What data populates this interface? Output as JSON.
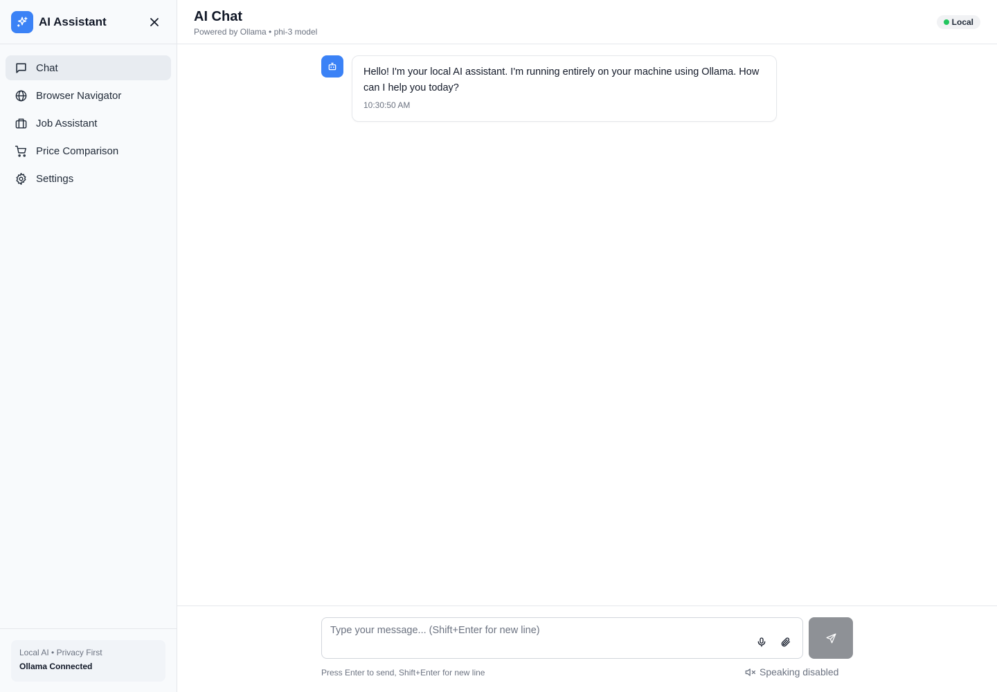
{
  "sidebar": {
    "app_title": "AI Assistant",
    "logo_icon": "sparkles-icon",
    "close_icon": "close-icon",
    "items": [
      {
        "label": "Chat",
        "icon": "chat-icon",
        "active": true
      },
      {
        "label": "Browser Navigator",
        "icon": "globe-icon",
        "active": false
      },
      {
        "label": "Job Assistant",
        "icon": "briefcase-icon",
        "active": false
      },
      {
        "label": "Price Comparison",
        "icon": "cart-icon",
        "active": false
      },
      {
        "label": "Settings",
        "icon": "gear-icon",
        "active": false
      }
    ],
    "footer": {
      "line1": "Local AI • Privacy First",
      "line2": "Ollama Connected"
    }
  },
  "header": {
    "title": "AI Chat",
    "subtitle": "Powered by Ollama • phi-3 model",
    "badge": "Local",
    "badge_color": "#22c55e"
  },
  "messages": [
    {
      "role": "assistant",
      "avatar_icon": "bot-icon",
      "text": "Hello! I'm your local AI assistant. I'm running entirely on your machine using Ollama. How can I help you today?",
      "time": "10:30:50 AM"
    }
  ],
  "composer": {
    "placeholder": "Type your message... (Shift+Enter for new line)",
    "hint": "Press Enter to send, Shift+Enter for new line",
    "speaking_label": "Speaking disabled",
    "mic_icon": "microphone-icon",
    "attach_icon": "paperclip-icon",
    "send_icon": "send-icon",
    "speaker_icon": "speaker-muted-icon"
  },
  "colors": {
    "accent": "#3b82f6",
    "send_button": "#8e9196",
    "sidebar_bg": "#f8fafc",
    "active_nav": "#e8ecf1"
  }
}
